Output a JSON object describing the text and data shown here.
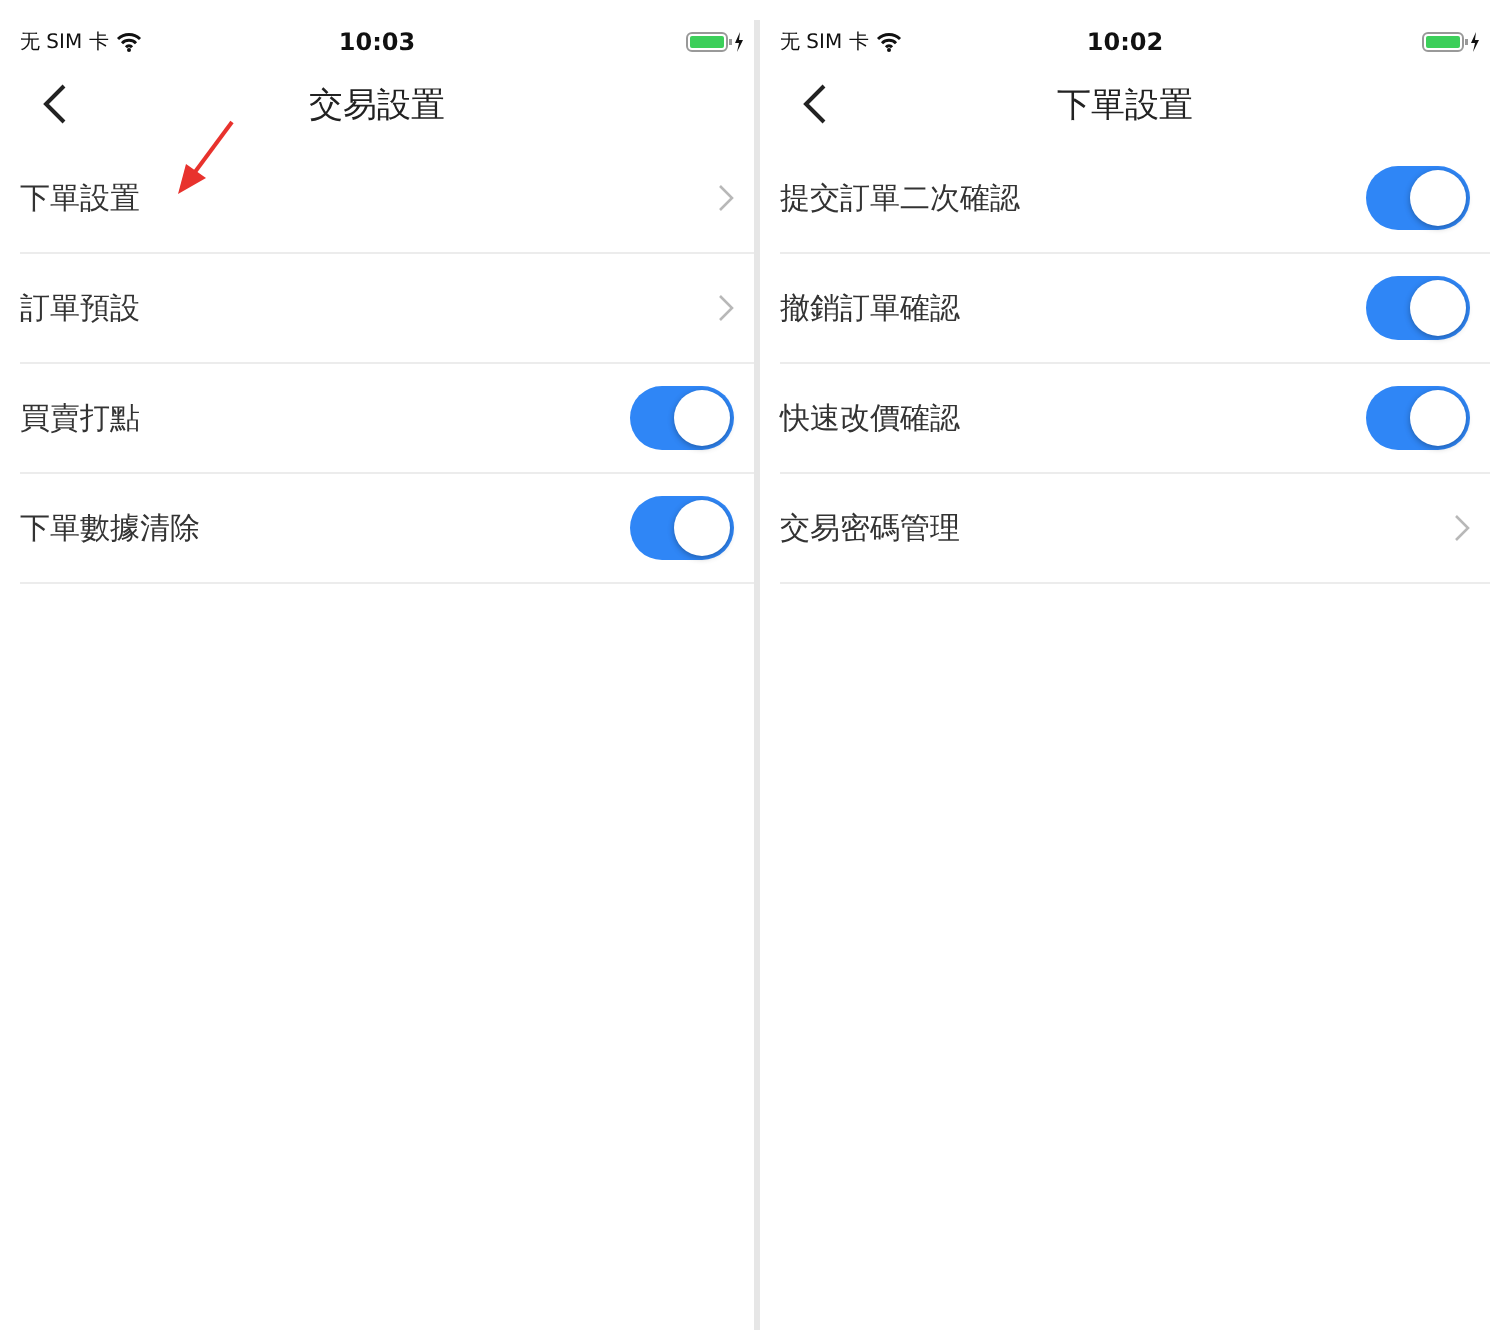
{
  "screens": [
    {
      "status_bar": {
        "carrier": "无 SIM 卡",
        "time": "10:03"
      },
      "title": "交易設置",
      "annotation_arrow": true,
      "rows": [
        {
          "label": "下單設置",
          "kind": "link"
        },
        {
          "label": "訂單預設",
          "kind": "link"
        },
        {
          "label": "買賣打點",
          "kind": "toggle",
          "on": true
        },
        {
          "label": "下單數據清除",
          "kind": "toggle",
          "on": true
        }
      ]
    },
    {
      "status_bar": {
        "carrier": "无 SIM 卡",
        "time": "10:02"
      },
      "title": "下單設置",
      "annotation_arrow": false,
      "rows": [
        {
          "label": "提交訂單二次確認",
          "kind": "toggle",
          "on": true
        },
        {
          "label": "撤銷訂單確認",
          "kind": "toggle",
          "on": true
        },
        {
          "label": "快速改價確認",
          "kind": "toggle",
          "on": true
        },
        {
          "label": "交易密碼管理",
          "kind": "link"
        }
      ]
    }
  ]
}
